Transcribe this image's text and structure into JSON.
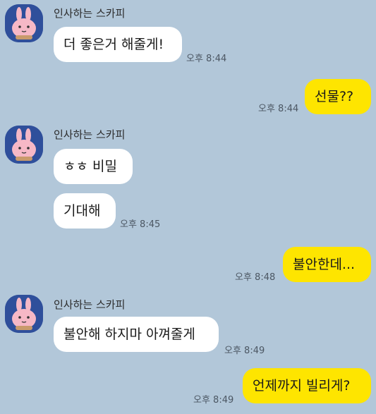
{
  "sender_name": "인사하는 스카피",
  "colors": {
    "background": "#b2c7d9",
    "incoming_bubble": "#ffffff",
    "outgoing_bubble": "#fee500",
    "avatar_bg": "#2f4f9b"
  },
  "messages": [
    {
      "text": "더 좋은거 해줄게!",
      "time": "오후 8:44"
    },
    {
      "text": "선물??",
      "time": "오후 8:44"
    },
    {
      "text": "ㅎㅎ 비밀"
    },
    {
      "text": "기대해",
      "time": "오후 8:45"
    },
    {
      "text": "불안한데...",
      "time": "오후 8:48"
    },
    {
      "text": "불안해 하지마 아껴줄게",
      "time": "오후 8:49"
    },
    {
      "text": "언제까지 빌리게?",
      "time": "오후 8:49"
    }
  ]
}
